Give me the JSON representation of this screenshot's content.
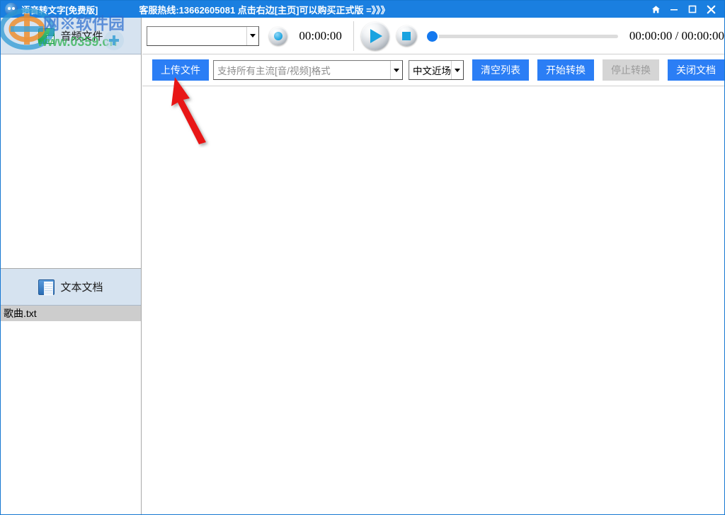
{
  "window": {
    "app_icon": "app-logo-icon",
    "title": "语音转文字[免费版]",
    "banner": "客服热线:13662605081  点击右边[主页]可以购买正式版 =》》》",
    "controls": {
      "home": "home-icon",
      "minimize": "minimize-icon",
      "maximize": "maximize-icon",
      "close": "close-icon"
    },
    "title_bar_color": "#1a7fe0"
  },
  "sidebar": {
    "audio_panel": {
      "icon": "audio-file-icon",
      "header": "音频文件",
      "items": []
    },
    "doc_panel": {
      "icon": "word-document-icon",
      "header": "文本文档",
      "items": [
        {
          "name": "歌曲.txt",
          "selected": true
        }
      ]
    },
    "header_bg": "#d6e3f0",
    "selected_bg": "#cdcdcd"
  },
  "player_toolbar": {
    "device_combo": {
      "value": "",
      "placeholder": ""
    },
    "record_button": "record-icon",
    "record_time": "00:00:00",
    "play_button": "play-icon",
    "stop_button": "stop-icon",
    "progress_value": 0,
    "total_time": "00:00:00 / 00:00:00"
  },
  "action_toolbar": {
    "upload_label": "上传文件",
    "file_combo": {
      "value": "",
      "placeholder": "支持所有主流[音/视频]格式"
    },
    "lang_combo": {
      "value": "中文近场"
    },
    "clear_label": "清空列表",
    "start_label": "开始转换",
    "stop_label": "停止转换",
    "stop_disabled": true,
    "close_doc_label": "关闭文档",
    "accent_color": "#2b7ef5",
    "disabled_color": "#d5d5d5"
  },
  "annotation": {
    "arrow": "red-pointer-arrow",
    "arrow_color": "#e81414",
    "target": "上传文件"
  },
  "watermark": {
    "site_text": "网※软件园",
    "url_text": "www.0359.cn",
    "logo": "site-logo-icon"
  }
}
